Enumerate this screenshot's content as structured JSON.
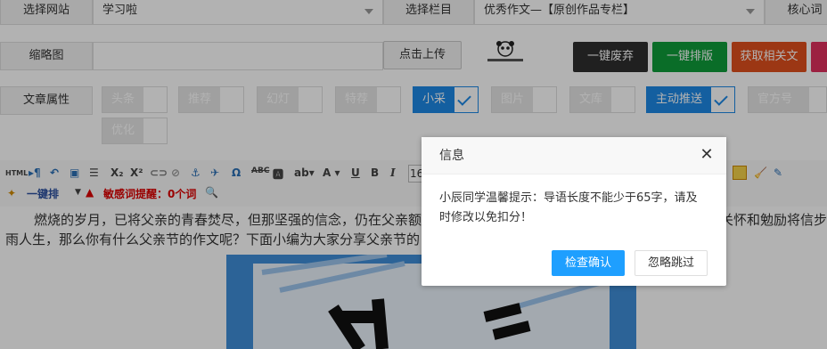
{
  "form": {
    "site_label": "选择网站",
    "site_value": "学习啦",
    "column_label": "选择栏目",
    "column_value": "优秀作文—【原创作品专栏】",
    "keyword_label": "核心词",
    "thumb_label": "缩略图",
    "upload_label": "点击上传",
    "buttons": {
      "discard": "一键废弃",
      "layout": "一键排版",
      "fetch": "获取相关文"
    },
    "attr_label": "文章属性",
    "attrs": [
      {
        "label": "头条",
        "checked": false
      },
      {
        "label": "推荐",
        "checked": false
      },
      {
        "label": "幻灯",
        "checked": false
      },
      {
        "label": "特荐",
        "checked": false
      },
      {
        "label": "小采",
        "checked": true
      },
      {
        "label": "图片",
        "checked": false
      },
      {
        "label": "文库",
        "checked": false
      },
      {
        "label": "主动推送",
        "checked": true
      },
      {
        "label": "官方号提交",
        "checked": false
      }
    ],
    "attr_optimize": "优化"
  },
  "toolbar": {
    "one_click": "一键排",
    "sensitive": "敏感词提醒：0个词",
    "font_size": "16"
  },
  "content": {
    "line1_a": "燃烧的岁月，已将父亲的青春焚尽，但那坚强的信念，仍在父亲额",
    "line1_b": "关怀和勉励将信步",
    "line2_a": "雨人生，那么你有什么父亲节的作文呢？下面小编为大家分享父亲节的"
  },
  "dialog": {
    "title": "信息",
    "message": "小辰同学温馨提示：导语长度不能少于65字，请及时修改以免扣分！",
    "confirm": "检查确认",
    "skip": "忽略跳过"
  },
  "colors": {
    "primary": "#1e9fff",
    "checked": "#1e88e5",
    "discard": "#2f2f2f",
    "layout": "#0f9d3a",
    "fetch": "#e0501e"
  }
}
